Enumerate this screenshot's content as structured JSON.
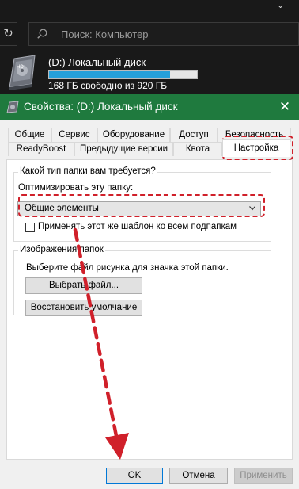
{
  "explorer": {
    "refresh_icon": "refresh-icon",
    "search_placeholder": "Поиск: Компьютер",
    "drive": {
      "name": "(D:) Локальный диск",
      "free_text": "168 ГБ свободно из 920 ГБ",
      "used_fraction": 0.82,
      "hdd_label": "HD"
    }
  },
  "dialog": {
    "title": "Свойства: (D:) Локальный диск",
    "close_glyph": "✕",
    "tabs_row1": [
      "Общие",
      "Сервис",
      "Оборудование",
      "Доступ",
      "Безопасность"
    ],
    "tabs_row2": [
      "ReadyBoost",
      "Предыдущие версии",
      "Квота",
      "Настройка"
    ],
    "active_tab": "Настройка",
    "folder_type": {
      "legend": "Какой тип папки вам требуется?",
      "optimize_label": "Оптимизировать эту папку:",
      "selected": "Общие элементы",
      "apply_checkbox_label": "Применять этот же шаблон ко всем подпапкам",
      "apply_checked": false
    },
    "folder_pictures": {
      "legend": "Изображения папок",
      "description": "Выберите файл рисунка для значка этой папки.",
      "choose_file_button": "Выбрать файл...",
      "restore_default_button": "Восстановить умолчание"
    },
    "buttons": {
      "ok": "OK",
      "cancel": "Отмена",
      "apply": "Применить"
    }
  },
  "colors": {
    "titlebar": "#1f7a3e",
    "annotation": "#d0202a",
    "progress": "#26a0da"
  }
}
